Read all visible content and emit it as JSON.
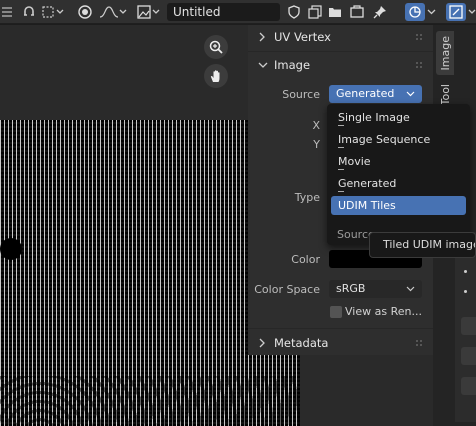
{
  "header": {
    "image_name": "Untitled"
  },
  "panel": {
    "uv_vertex_header": "UV Vertex",
    "image_header": "Image",
    "source_label": "Source",
    "source_value": "Generated",
    "x_label": "X",
    "y_label": "Y",
    "type_label": "Type",
    "color_label": "Color",
    "color_space_label": "Color Space",
    "color_space_value": "sRGB",
    "view_as_render": "View as Ren...",
    "metadata_header": "Metadata"
  },
  "tabs": {
    "image": "Image",
    "tool": "Tool"
  },
  "menu": {
    "title": "Source",
    "items": [
      "Single Image",
      "Image Sequence",
      "Movie",
      "Generated",
      "UDIM Tiles"
    ],
    "highlighted": "UDIM Tiles"
  },
  "tooltip": {
    "text": "Tiled UDIM image t"
  },
  "colors": {
    "accent": "#4772b3",
    "panel": "#2e2e2e",
    "header": "#303030",
    "menu_bg": "#181818"
  }
}
